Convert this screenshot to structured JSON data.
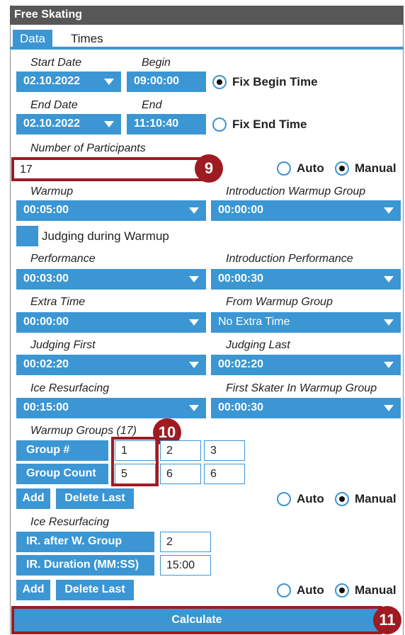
{
  "panel_title": "Free Skating",
  "tabs": [
    {
      "label": "Data"
    },
    {
      "label": "Times"
    }
  ],
  "start_date": {
    "label": "Start Date",
    "value": "02.10.2022"
  },
  "begin": {
    "label": "Begin",
    "value": "09:00:00"
  },
  "fix_begin": {
    "label": "Fix Begin Time",
    "checked": true
  },
  "end_date": {
    "label": "End Date",
    "value": "02.10.2022"
  },
  "end": {
    "label": "End",
    "value": "11:10:40"
  },
  "fix_end": {
    "label": "Fix End Time",
    "checked": false
  },
  "participants": {
    "label": "Number of Participants",
    "value": "17"
  },
  "mode_labels": {
    "auto": "Auto",
    "manual": "Manual"
  },
  "warmup": {
    "label": "Warmup",
    "value": "00:05:00"
  },
  "intro_warmup": {
    "label": "Introduction Warmup Group",
    "value": "00:00:00"
  },
  "judging_warmup": {
    "label": "Judging during Warmup"
  },
  "performance": {
    "label": "Performance",
    "value": "00:03:00"
  },
  "intro_performance": {
    "label": "Introduction Performance",
    "value": "00:00:30"
  },
  "extra_time": {
    "label": "Extra Time",
    "value": "00:00:00"
  },
  "from_warmup": {
    "label": "From Warmup Group",
    "value": "No Extra Time"
  },
  "judging_first": {
    "label": "Judging First",
    "value": "00:02:20"
  },
  "judging_last": {
    "label": "Judging Last",
    "value": "00:02:20"
  },
  "ice_resurfacing": {
    "label": "Ice Resurfacing",
    "value": "00:15:00"
  },
  "first_skater": {
    "label": "First Skater In Warmup Group",
    "value": "00:00:30"
  },
  "warmup_groups": {
    "label": "Warmup Groups (17)",
    "group_num_label": "Group #",
    "group_count_label": "Group Count",
    "group_nums": [
      "1",
      "2",
      "3"
    ],
    "group_counts": [
      "5",
      "6",
      "6"
    ]
  },
  "buttons": {
    "add": "Add",
    "delete_last": "Delete Last",
    "calculate": "Calculate"
  },
  "ir": {
    "label": "Ice Resurfacing",
    "after_label": "IR. after W. Group",
    "after_value": "2",
    "duration_label": "IR. Duration (MM:SS)",
    "duration_value": "15:00"
  },
  "markers": {
    "m9": "9",
    "m10": "10",
    "m11": "11"
  },
  "colors": {
    "accent": "#3b96d3",
    "highlight": "#9e1b22",
    "title_bar": "#575757"
  }
}
